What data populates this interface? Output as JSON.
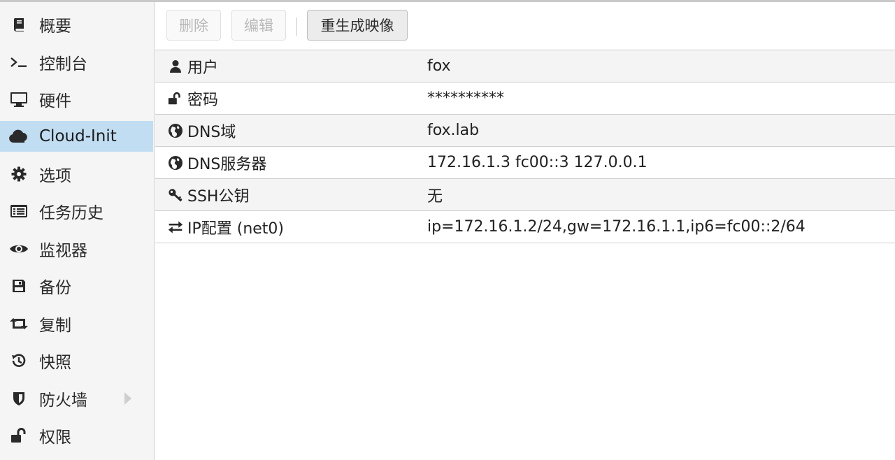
{
  "sidebar": {
    "items": [
      {
        "label": "概要",
        "icon": "book-icon"
      },
      {
        "label": "控制台",
        "icon": "terminal-icon"
      },
      {
        "label": "硬件",
        "icon": "monitor-icon"
      },
      {
        "label": "Cloud-Init",
        "icon": "cloud-icon",
        "selected": true
      },
      {
        "label": "选项",
        "icon": "gear-icon"
      },
      {
        "label": "任务历史",
        "icon": "list-icon"
      },
      {
        "label": "监视器",
        "icon": "eye-icon"
      },
      {
        "label": "备份",
        "icon": "floppy-icon"
      },
      {
        "label": "复制",
        "icon": "retweet-icon"
      },
      {
        "label": "快照",
        "icon": "history-icon"
      },
      {
        "label": "防火墙",
        "icon": "shield-icon",
        "expandable": true
      },
      {
        "label": "权限",
        "icon": "unlock-icon"
      }
    ]
  },
  "toolbar": {
    "delete_label": "删除",
    "edit_label": "编辑",
    "regenerate_label": "重生成映像"
  },
  "grid": {
    "rows": [
      {
        "key": "用户",
        "icon": "user-icon",
        "value": "fox"
      },
      {
        "key": "密码",
        "icon": "unlock-icon",
        "value": "**********"
      },
      {
        "key": "DNS域",
        "icon": "globe-icon",
        "value": "fox.lab"
      },
      {
        "key": "DNS服务器",
        "icon": "globe-icon",
        "value": "172.16.1.3 fc00::3 127.0.0.1"
      },
      {
        "key": "SSH公钥",
        "icon": "key-icon",
        "value": "无"
      },
      {
        "key": "IP配置 (net0)",
        "icon": "exchange-icon",
        "value": "ip=172.16.1.2/24,gw=172.16.1.1,ip6=fc00::2/64"
      }
    ]
  },
  "colors": {
    "selected_bg": "#c1ddf1",
    "sidebar_bg": "#f5f5f5",
    "alt_row_bg": "#f4f4f4"
  }
}
